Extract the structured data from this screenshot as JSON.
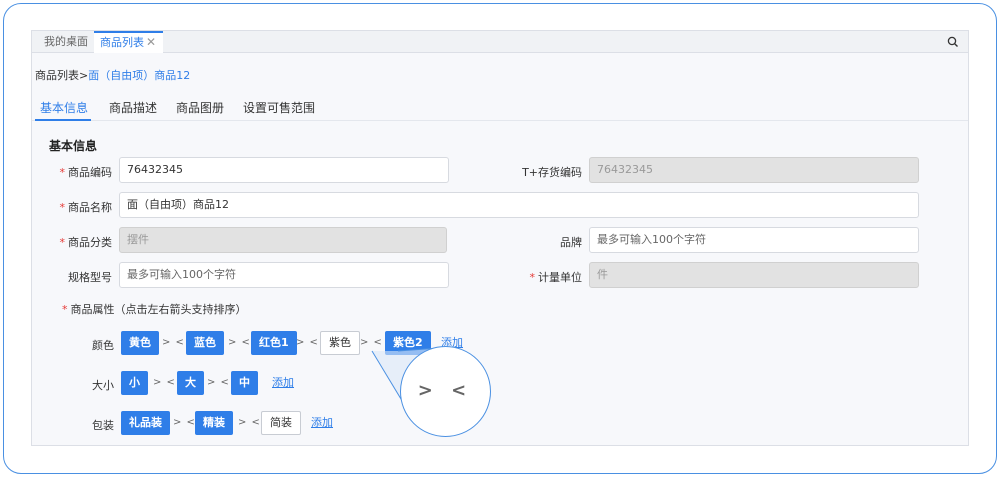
{
  "tabbar": {
    "tabs": [
      {
        "label": "我的桌面"
      },
      {
        "label": "商品列表"
      }
    ],
    "close_glyph": "✕",
    "search_icon": "search-icon"
  },
  "breadcrumb": {
    "parent": "商品列表>",
    "current": "面（自由项）商品12"
  },
  "tabs": [
    "基本信息",
    "商品描述",
    "商品图册",
    "设置可售范围"
  ],
  "section_title": "基本信息",
  "form": {
    "code_label": "商品编码",
    "code_value": "76432345",
    "t_code_label": "T+存货编码",
    "t_code_value": "76432345",
    "name_label": "商品名称",
    "name_value": "面（自由项）商品12",
    "category_label": "商品分类",
    "category_value": "摆件",
    "brand_label": "品牌",
    "brand_placeholder": "最多可输入100个字符",
    "spec_label": "规格型号",
    "spec_placeholder": "最多可输入100个字符",
    "unit_label": "计量单位",
    "unit_value": "件",
    "attr_label": "商品属性（点击左右箭头支持排序）"
  },
  "attributes": {
    "color": {
      "label": "颜色",
      "values": [
        "黄色",
        "蓝色",
        "红色1",
        "紫色",
        "紫色2"
      ]
    },
    "size": {
      "label": "大小",
      "values": [
        "小",
        "大",
        "中"
      ]
    },
    "package": {
      "label": "包装",
      "values": [
        "礼品装",
        "精装",
        "简装"
      ]
    },
    "add_label": "添加",
    "arrows": "> <"
  },
  "zoom_text": "> <",
  "colors": {
    "accent": "#2f7ee8",
    "required": "#e53935",
    "frame": "#4a90e2"
  }
}
